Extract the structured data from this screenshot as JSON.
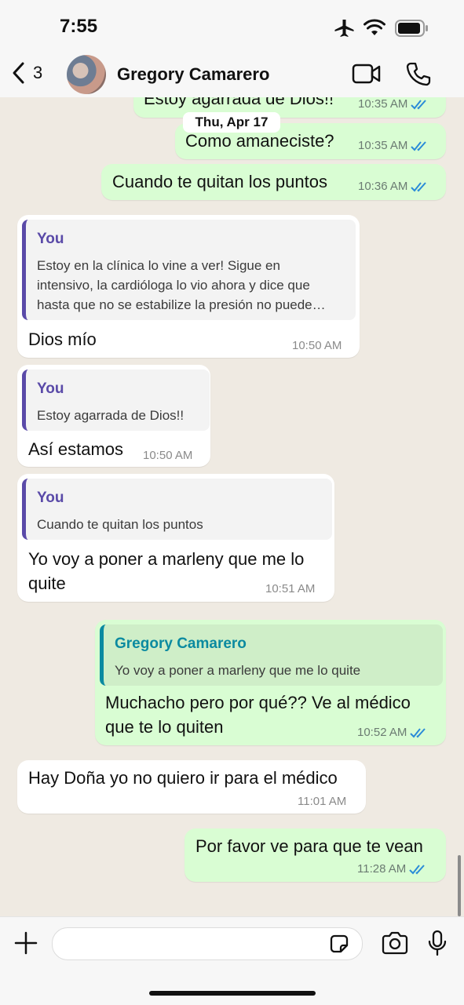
{
  "status": {
    "time": "7:55"
  },
  "header": {
    "back_count": "3",
    "contact_name": "Gregory Camarero"
  },
  "date_chip": "Thu, Apr 17",
  "messages": [
    {
      "text": "Estoy agarrada de Dios!!",
      "time": "10:35 AM"
    },
    {
      "text": "Como amaneciste?",
      "time": "10:35 AM"
    },
    {
      "text": "Cuando te quitan los puntos",
      "time": "10:36 AM"
    },
    {
      "quote_name": "You",
      "quote_lines": [
        "Estoy en la clínica lo vine a ver! Sigue en",
        "intensivo, la cardióloga lo vio ahora y dice que",
        "hasta que no se estabilize la presión no puede…"
      ],
      "text": "Dios mío",
      "time": "10:50 AM"
    },
    {
      "quote_name": "You",
      "quote_lines": [
        "Estoy agarrada de Dios!!"
      ],
      "text": "Así estamos",
      "time": "10:50 AM"
    },
    {
      "quote_name": "You",
      "quote_lines": [
        "Cuando te quitan los puntos"
      ],
      "text_lines": [
        "Yo voy a poner a marleny que me lo",
        "quite"
      ],
      "time": "10:51 AM"
    },
    {
      "quote_name": "Gregory Camarero",
      "quote_lines": [
        "Yo voy a poner a marleny que me lo quite"
      ],
      "text_lines": [
        "Muchacho pero por qué?? Ve al médico",
        "que te lo quiten"
      ],
      "time": "10:52 AM"
    },
    {
      "text": "Hay Doña yo no quiero ir para el médico",
      "time": "11:01 AM"
    },
    {
      "text": "Por favor ve para que te vean",
      "time": "11:28 AM"
    }
  ],
  "colors": {
    "outgoing": "#d9fdd3",
    "incoming": "#ffffff",
    "read_ticks": "#2a8bd8",
    "quote_you": "#5a4aa8",
    "quote_contact": "#0b8aa0"
  }
}
